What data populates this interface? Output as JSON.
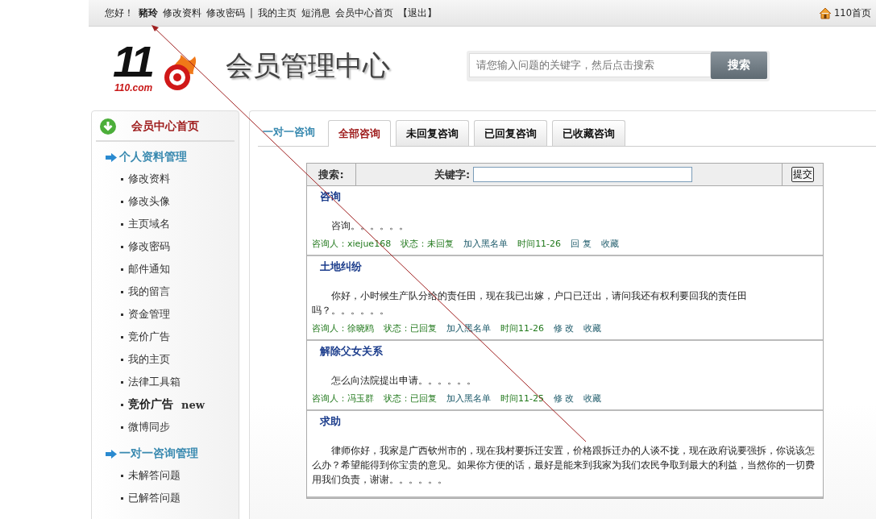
{
  "top_bar": {
    "greeting": "您好！",
    "user": "豬玲",
    "links": [
      "修改资料",
      "修改密码",
      "|",
      "我的主页",
      "短消息",
      "会员中心首页",
      "【退出】"
    ],
    "home_link": "110首页"
  },
  "header": {
    "logo": {
      "mark": "11",
      "domain": "110.com"
    },
    "title": "会员管理中心",
    "search": {
      "placeholder": "请您输入问题的关键字，然后点击搜索",
      "button": "搜索"
    }
  },
  "sidebar": {
    "home": "会员中心首页",
    "sections": [
      {
        "title": "个人资料管理",
        "items": [
          {
            "label": "修改资料",
            "kind": "link"
          },
          {
            "label": "修改头像",
            "kind": "link"
          },
          {
            "label": "主页域名",
            "kind": "link"
          },
          {
            "label": "修改密码",
            "kind": "link"
          },
          {
            "label": "邮件通知",
            "kind": "link"
          },
          {
            "label": "我的留言",
            "kind": "link"
          },
          {
            "label": "资金管理",
            "kind": "link"
          },
          {
            "label": "竞价广告",
            "kind": "link"
          },
          {
            "label": "我的主页",
            "kind": "link"
          },
          {
            "label": "法律工具箱",
            "kind": "link"
          },
          {
            "label": "竞价广告",
            "kind": "new",
            "badge": "new"
          },
          {
            "label": "微博同步",
            "kind": "link"
          }
        ]
      },
      {
        "title": "一对一咨询管理",
        "items": [
          {
            "label": "未解答问题",
            "kind": "link"
          },
          {
            "label": "已解答问题",
            "kind": "link"
          }
        ]
      }
    ]
  },
  "main": {
    "heading": "一对一咨询",
    "tabs": [
      {
        "label": "全部咨询",
        "selected": true
      },
      {
        "label": "未回复咨询",
        "selected": false
      },
      {
        "label": "已回复咨询",
        "selected": false
      },
      {
        "label": "已收藏咨询",
        "selected": false
      }
    ],
    "search_row": {
      "label": "搜索:",
      "keyword_label": "关键字:",
      "submit": "提交"
    },
    "consultations": [
      {
        "title": "咨询",
        "body": "咨询。。。。。。",
        "asker": "咨询人：xiejue168",
        "status_label": "状态：",
        "status": "未回复",
        "blacklist": "加入黑名单",
        "time": "时间11-26",
        "action": "回 复",
        "favorite": "收藏"
      },
      {
        "title": "土地纠纷",
        "body": "你好，小时候生产队分给的责任田，现在我已出嫁，户口已迁出，请问我还有权利要回我的责任田吗？。。。。。。",
        "asker": "咨询人：徐晓鸥",
        "status_label": "状态：",
        "status": "已回复",
        "blacklist": "加入黑名单",
        "time": "时间11-26",
        "action": "修 改",
        "favorite": "收藏"
      },
      {
        "title": "解除父女关系",
        "body": "怎么向法院提出申请。。。。。。",
        "asker": "咨询人：冯玉群",
        "status_label": "状态：",
        "status": "已回复",
        "blacklist": "加入黑名单",
        "time": "时间11-25",
        "action": "修 改",
        "favorite": "收藏"
      },
      {
        "title": "求助",
        "body": "律师你好，我家是广西钦州市的，现在我村要拆迁安置，价格跟拆迁办的人谈不拢，现在政府说要强拆，你说该怎么办？希望能得到你宝贵的意见。如果你方便的话，最好是能来到我家为我们农民争取到最大的利益，当然你的一切费用我们负责，谢谢。。。。。。"
      }
    ]
  }
}
